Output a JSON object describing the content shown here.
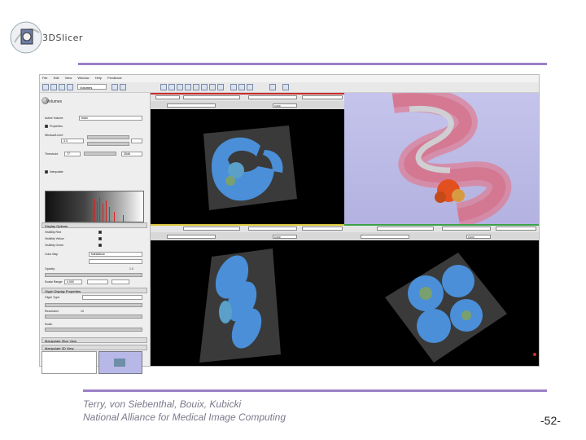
{
  "logo": {
    "text": "3DSlicer"
  },
  "accent_color": "#9b7fc7",
  "app": {
    "menu": [
      "File",
      "Edit",
      "View",
      "Window",
      "Help",
      "Feedback"
    ],
    "module": {
      "title": "Volumes"
    },
    "panel": {
      "active_volume_label": "Active Volume:",
      "active_volume_value": "brain",
      "properties_label": "Properties",
      "window_level_label": "Window/Level:",
      "window_value": "3.3",
      "threshold_label": "Threshold:",
      "threshold_min": "77",
      "threshold_max": "2546",
      "interpolate_label": "Interpolate",
      "display_section": "Display Options",
      "visible_row": "Visibility Red",
      "visible_yellow": "Visibility Yellow",
      "visible_green": "Visibility Green",
      "colormap_label": "Color Map",
      "colormap_value": "fullrainbow",
      "opacity_label": "Opacity:",
      "opacity_value": "1.0",
      "scalar_range_label": "Scalar Range:",
      "scalar_range_value": "0.000",
      "glyph_section": "Glyph Display Properties",
      "glyph_type_label": "Glyph Type:",
      "resolution_label": "Resolution:",
      "resolution_value": "10",
      "scale_label": "Scale:",
      "navigation_section": "Manipulate 3D View",
      "annotation_section": "Manipulate Slice View"
    }
  },
  "views": {
    "red": {
      "offset_label": "Offset",
      "value": "0.000"
    },
    "yellow": {
      "offset_label": "Offset",
      "value": "0.000"
    },
    "green": {
      "offset_label": "Offset",
      "value": "0.000"
    },
    "colors": {
      "red": "#cc2a2a",
      "yellow": "#d8c43a",
      "green": "#3aa14a"
    }
  },
  "footer": {
    "authors": "Terry, von Siebenthal, Bouix, Kubicki",
    "org": "National Alliance for Medical Image Computing",
    "page": "-52-"
  }
}
